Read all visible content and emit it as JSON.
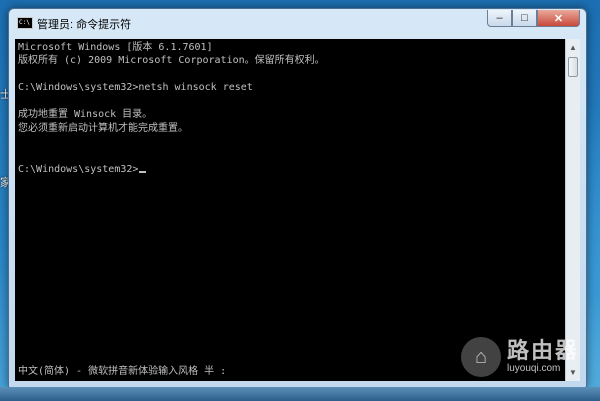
{
  "window": {
    "title": "管理员: 命令提示符",
    "icon_label": "C:\\",
    "minimize_label": "–",
    "maximize_label": "□",
    "close_label": "✕"
  },
  "console": {
    "lines": [
      "Microsoft Windows [版本 6.1.7601]",
      "版权所有 (c) 2009 Microsoft Corporation。保留所有权利。",
      "",
      "C:\\Windows\\system32>netsh winsock reset",
      "",
      "成功地重置 Winsock 目录。",
      "您必须重新启动计算机才能完成重置。",
      "",
      "",
      "C:\\Windows\\system32>"
    ],
    "ime_status": "中文(简体) - 微软拼音新体验输入风格 半 :"
  },
  "desktop": {
    "glyph_1": "士",
    "glyph_2": "家"
  },
  "watermark": {
    "text": "路由器",
    "url": "luyouqi.com"
  },
  "icons": {
    "app": "cmd-icon",
    "minimize": "minimize-icon",
    "maximize": "maximize-icon",
    "close": "close-icon",
    "scroll_up": "scroll-up-arrow-icon",
    "scroll_down": "scroll-down-arrow-icon",
    "watermark": "router-logo-icon"
  },
  "colors": {
    "console_bg": "#000000",
    "console_text": "#c0c0c0",
    "close_button": "#c8493a"
  }
}
